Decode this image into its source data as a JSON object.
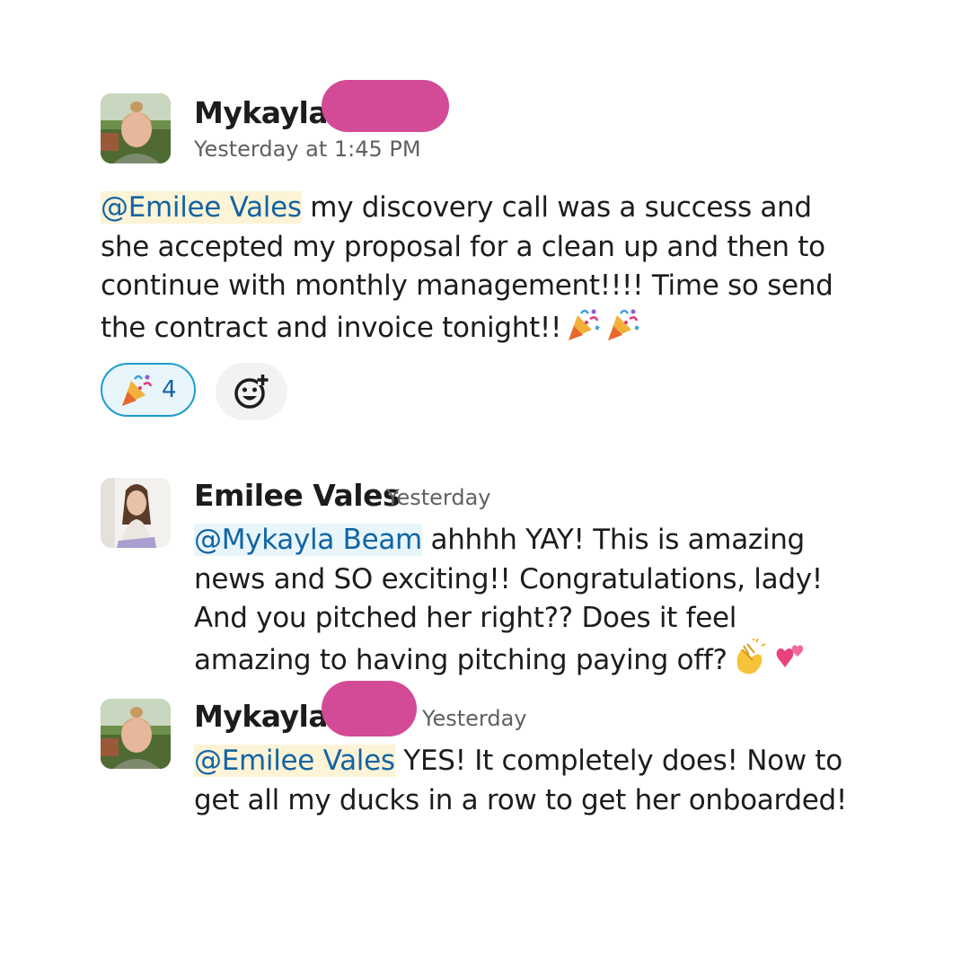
{
  "messages": [
    {
      "author": "Mykayla",
      "timestamp": "Yesterday at 1:45 PM",
      "mention": "@Emilee Vales",
      "text_lines": [
        " my discovery call was a success and",
        "she accepted my proposal for a clean up and then to",
        "continue with monthly management!!!! Time so send",
        "the contract and invoice tonight!!"
      ],
      "trailing_emoji": [
        "party-popper",
        "party-popper"
      ],
      "reactions": [
        {
          "emoji": "party-popper",
          "count": "4"
        }
      ]
    },
    {
      "author": "Emilee Vales",
      "timestamp": "Yesterday",
      "mention": "@Mykayla Beam",
      "text_lines": [
        " ahhhh YAY! This is amazing",
        "news and SO exciting!! Congratulations, lady!",
        "And you pitched her right?? Does it feel",
        "amazing to having pitching paying off?"
      ],
      "trailing_emoji": [
        "clapping-hands",
        "two-hearts"
      ]
    },
    {
      "author": "Mykayla",
      "timestamp": "Yesterday",
      "mention": "@Emilee Vales",
      "text_lines": [
        " YES! It completely does! Now to",
        "get all my ducks in a row to get her onboarded!"
      ]
    }
  ],
  "colors": {
    "mention": "#1264a3",
    "redaction": "#d34a96",
    "reaction_border": "#1d9bd1",
    "reaction_bg": "#e8f5fa"
  }
}
